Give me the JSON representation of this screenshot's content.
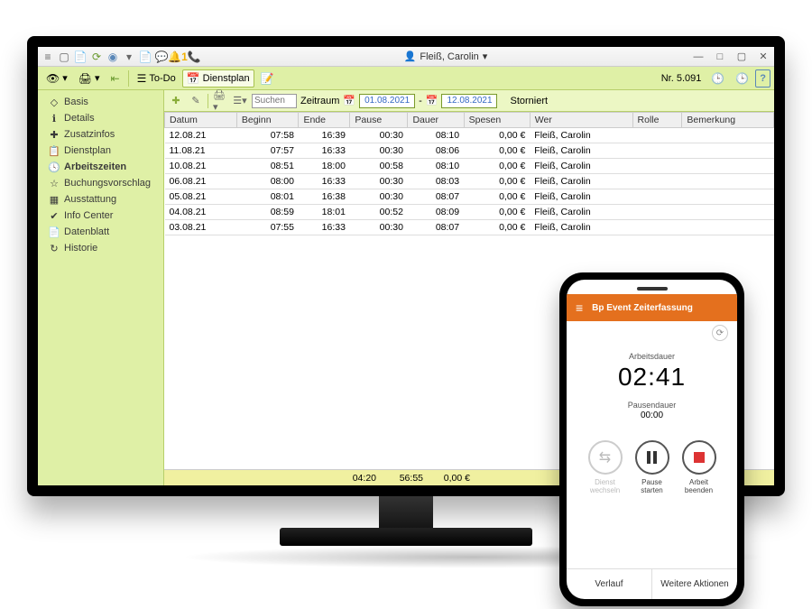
{
  "titlebar": {
    "user_name": "Fleiß, Carolin",
    "bell_count": "1"
  },
  "toolbar": {
    "todo_label": "To-Do",
    "dienstplan_label": "Dienstplan",
    "nr_label": "Nr. 5.091"
  },
  "sidebar": {
    "items": [
      {
        "label": "Basis",
        "icon": "◇"
      },
      {
        "label": "Details",
        "icon": "ℹ"
      },
      {
        "label": "Zusatzinfos",
        "icon": "✚"
      },
      {
        "label": "Dienstplan",
        "icon": "📋"
      },
      {
        "label": "Arbeitszeiten",
        "icon": "🕓"
      },
      {
        "label": "Buchungsvorschlag",
        "icon": "☆"
      },
      {
        "label": "Ausstattung",
        "icon": "▦"
      },
      {
        "label": "Info Center",
        "icon": "✔"
      },
      {
        "label": "Datenblatt",
        "icon": "📄"
      },
      {
        "label": "Historie",
        "icon": "↻"
      }
    ]
  },
  "content_toolbar": {
    "search_placeholder": "Suchen",
    "zeitraum_label": "Zeitraum",
    "date_from": "01.08.2021",
    "date_to": "12.08.2021",
    "storniert_label": "Storniert"
  },
  "table": {
    "columns": [
      "Datum",
      "Beginn",
      "Ende",
      "Pause",
      "Dauer",
      "Spesen",
      "Wer",
      "Rolle",
      "Bemerkung"
    ],
    "rows": [
      {
        "datum": "12.08.21",
        "beginn": "07:58",
        "ende": "16:39",
        "pause": "00:30",
        "dauer": "08:10",
        "spesen": "0,00 €",
        "wer": "Fleiß, Carolin",
        "rolle": "",
        "bemerkung": ""
      },
      {
        "datum": "11.08.21",
        "beginn": "07:57",
        "ende": "16:33",
        "pause": "00:30",
        "dauer": "08:06",
        "spesen": "0,00 €",
        "wer": "Fleiß, Carolin",
        "rolle": "",
        "bemerkung": ""
      },
      {
        "datum": "10.08.21",
        "beginn": "08:51",
        "ende": "18:00",
        "pause": "00:58",
        "dauer": "08:10",
        "spesen": "0,00 €",
        "wer": "Fleiß, Carolin",
        "rolle": "",
        "bemerkung": ""
      },
      {
        "datum": "06.08.21",
        "beginn": "08:00",
        "ende": "16:33",
        "pause": "00:30",
        "dauer": "08:03",
        "spesen": "0,00 €",
        "wer": "Fleiß, Carolin",
        "rolle": "",
        "bemerkung": ""
      },
      {
        "datum": "05.08.21",
        "beginn": "08:01",
        "ende": "16:38",
        "pause": "00:30",
        "dauer": "08:07",
        "spesen": "0,00 €",
        "wer": "Fleiß, Carolin",
        "rolle": "",
        "bemerkung": ""
      },
      {
        "datum": "04.08.21",
        "beginn": "08:59",
        "ende": "18:01",
        "pause": "00:52",
        "dauer": "08:09",
        "spesen": "0,00 €",
        "wer": "Fleiß, Carolin",
        "rolle": "",
        "bemerkung": ""
      },
      {
        "datum": "03.08.21",
        "beginn": "07:55",
        "ende": "16:33",
        "pause": "00:30",
        "dauer": "08:07",
        "spesen": "0,00 €",
        "wer": "Fleiß, Carolin",
        "rolle": "",
        "bemerkung": ""
      }
    ]
  },
  "statusbar": {
    "pause_total": "04:20",
    "dauer_total": "56:55",
    "spesen_total": "0,00 €"
  },
  "phone": {
    "header_title": "Bp Event Zeiterfassung",
    "arbeitsdauer_label": "Arbeitsdauer",
    "arbeitsdauer_value": "02:41",
    "pausendauer_label": "Pausendauer",
    "pausendauer_value": "00:00",
    "actions": {
      "dienst_wechseln": "Dienst\nwechseln",
      "pause_starten": "Pause\nstarten",
      "arbeit_beenden": "Arbeit\nbeenden"
    },
    "footer": {
      "verlauf": "Verlauf",
      "weitere": "Weitere Aktionen"
    }
  }
}
